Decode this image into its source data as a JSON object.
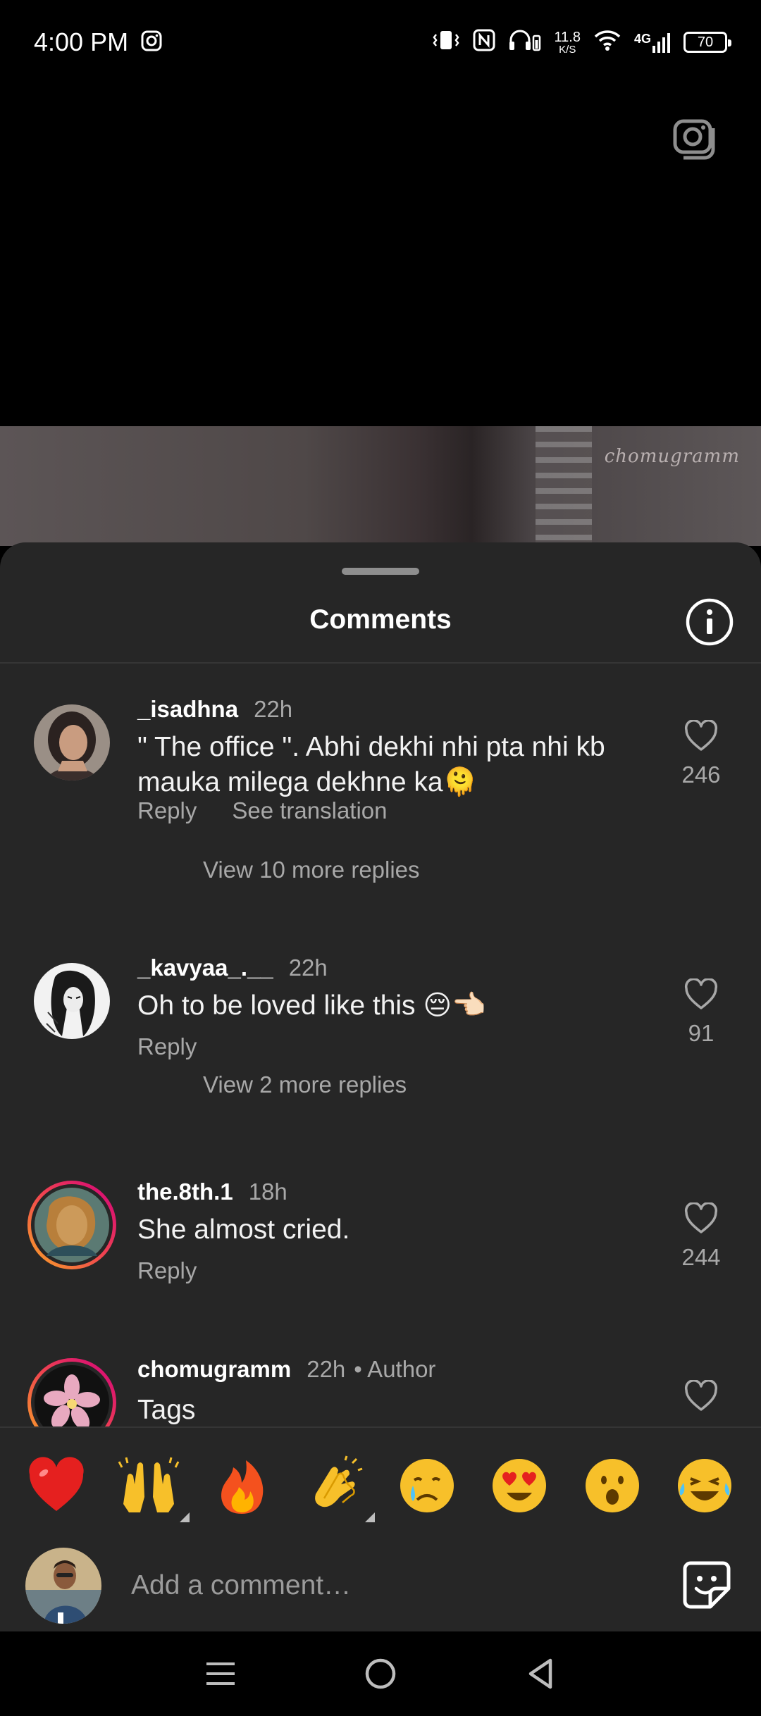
{
  "status_bar": {
    "time": "4:00 PM",
    "net_speed_value": "11.8",
    "net_speed_unit": "K/S",
    "network": "4G",
    "battery": "70",
    "icons": [
      "instagram-icon",
      "vibrate-icon",
      "nfc-icon",
      "headphones-icon",
      "wifi-icon",
      "signal-icon"
    ]
  },
  "video": {
    "watermark": "chomugramm",
    "camera_icon": "camera-icon"
  },
  "comments_sheet": {
    "title": "Comments",
    "info_icon": "info-icon",
    "comments": [
      {
        "username": "_isadhna",
        "time": "22h",
        "text": "\" The office \". Abhi dekhi nhi pta nhi kb mauka milega dekhne ka🫠",
        "reply_label": "Reply",
        "translation_label": "See translation",
        "likes": "246",
        "view_replies": "View 10 more replies"
      },
      {
        "username": "_kavyaa_.__",
        "time": "22h",
        "text": "Oh to be loved like this 😔👈🏻",
        "reply_label": "Reply",
        "likes": "91",
        "view_replies": "View 2 more replies"
      },
      {
        "username": "the.8th.1",
        "time": "18h",
        "text": "She almost cried.",
        "reply_label": "Reply",
        "likes": "244"
      },
      {
        "username": "chomugramm",
        "time": "22h",
        "author_label": "• Author",
        "text": "Tags"
      }
    ]
  },
  "emoji_bar": {
    "emojis": [
      "❤️",
      "🙌",
      "🔥",
      "👏",
      "😢",
      "😍",
      "😮",
      "😂"
    ]
  },
  "add_comment": {
    "placeholder": "Add a comment…",
    "sticker_icon": "sticker-icon"
  },
  "nav_bar": {
    "icons": [
      "menu-icon",
      "home-icon",
      "back-icon"
    ]
  },
  "colors": {
    "sheet_bg": "#262626",
    "secondary_text": "#a8a8a8",
    "story_ring_start": "#f9a825",
    "story_ring_end": "#d3007d"
  }
}
